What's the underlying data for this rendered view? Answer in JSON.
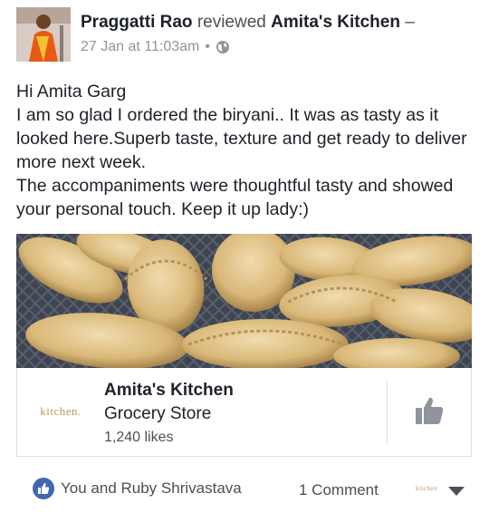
{
  "post": {
    "author": "Praggatti Rao",
    "verb": "reviewed",
    "target_page": "Amita's Kitchen",
    "separator": "–",
    "timestamp": "27 Jan at 11:03am",
    "dot": "•",
    "privacy_icon": "globe-icon",
    "body_lines": [
      "Hi Amita Garg",
      "I am so glad I ordered the biryani.. It was as tasty as it looked here.Superb taste, texture and get ready to deliver more next week.",
      "The accompaniments were thoughtful tasty and showed your personal touch. Keep it up lady:)"
    ]
  },
  "page_card": {
    "logo_text": "kitchen.",
    "name": "Amita's Kitchen",
    "category": "Grocery Store",
    "likes": "1,240 likes",
    "like_button_icon": "thumbs-up-icon"
  },
  "footer": {
    "reactions_icon": "like-reaction-icon",
    "reactions_text": "You and Ruby Shrivastava",
    "comments": "1 Comment",
    "actor_logo_text": "kitchen",
    "menu_icon": "chevron-down-icon"
  },
  "colors": {
    "text": "#1d2129",
    "secondary": "#4b4f56",
    "meta": "#90949c",
    "facebook_blue": "#4267b2",
    "gold": "#b59a55"
  }
}
